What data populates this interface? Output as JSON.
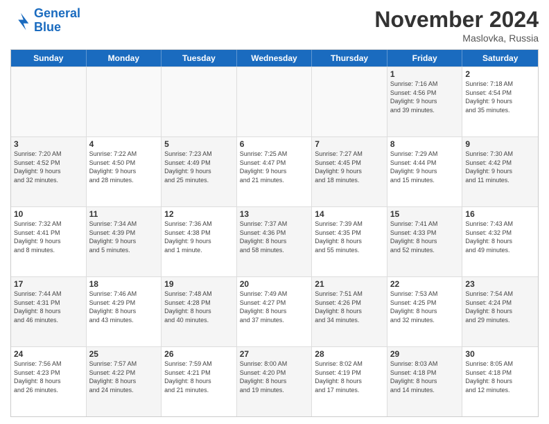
{
  "header": {
    "logo_line1": "General",
    "logo_line2": "Blue",
    "month": "November 2024",
    "location": "Maslovka, Russia"
  },
  "days_of_week": [
    "Sunday",
    "Monday",
    "Tuesday",
    "Wednesday",
    "Thursday",
    "Friday",
    "Saturday"
  ],
  "rows": [
    [
      {
        "day": "",
        "info": "",
        "empty": true
      },
      {
        "day": "",
        "info": "",
        "empty": true
      },
      {
        "day": "",
        "info": "",
        "empty": true
      },
      {
        "day": "",
        "info": "",
        "empty": true
      },
      {
        "day": "",
        "info": "",
        "empty": true
      },
      {
        "day": "1",
        "info": "Sunrise: 7:16 AM\nSunset: 4:56 PM\nDaylight: 9 hours\nand 39 minutes.",
        "shaded": true
      },
      {
        "day": "2",
        "info": "Sunrise: 7:18 AM\nSunset: 4:54 PM\nDaylight: 9 hours\nand 35 minutes.",
        "shaded": false
      }
    ],
    [
      {
        "day": "3",
        "info": "Sunrise: 7:20 AM\nSunset: 4:52 PM\nDaylight: 9 hours\nand 32 minutes.",
        "shaded": true
      },
      {
        "day": "4",
        "info": "Sunrise: 7:22 AM\nSunset: 4:50 PM\nDaylight: 9 hours\nand 28 minutes.",
        "shaded": false
      },
      {
        "day": "5",
        "info": "Sunrise: 7:23 AM\nSunset: 4:49 PM\nDaylight: 9 hours\nand 25 minutes.",
        "shaded": true
      },
      {
        "day": "6",
        "info": "Sunrise: 7:25 AM\nSunset: 4:47 PM\nDaylight: 9 hours\nand 21 minutes.",
        "shaded": false
      },
      {
        "day": "7",
        "info": "Sunrise: 7:27 AM\nSunset: 4:45 PM\nDaylight: 9 hours\nand 18 minutes.",
        "shaded": true
      },
      {
        "day": "8",
        "info": "Sunrise: 7:29 AM\nSunset: 4:44 PM\nDaylight: 9 hours\nand 15 minutes.",
        "shaded": false
      },
      {
        "day": "9",
        "info": "Sunrise: 7:30 AM\nSunset: 4:42 PM\nDaylight: 9 hours\nand 11 minutes.",
        "shaded": true
      }
    ],
    [
      {
        "day": "10",
        "info": "Sunrise: 7:32 AM\nSunset: 4:41 PM\nDaylight: 9 hours\nand 8 minutes.",
        "shaded": false
      },
      {
        "day": "11",
        "info": "Sunrise: 7:34 AM\nSunset: 4:39 PM\nDaylight: 9 hours\nand 5 minutes.",
        "shaded": true
      },
      {
        "day": "12",
        "info": "Sunrise: 7:36 AM\nSunset: 4:38 PM\nDaylight: 9 hours\nand 1 minute.",
        "shaded": false
      },
      {
        "day": "13",
        "info": "Sunrise: 7:37 AM\nSunset: 4:36 PM\nDaylight: 8 hours\nand 58 minutes.",
        "shaded": true
      },
      {
        "day": "14",
        "info": "Sunrise: 7:39 AM\nSunset: 4:35 PM\nDaylight: 8 hours\nand 55 minutes.",
        "shaded": false
      },
      {
        "day": "15",
        "info": "Sunrise: 7:41 AM\nSunset: 4:33 PM\nDaylight: 8 hours\nand 52 minutes.",
        "shaded": true
      },
      {
        "day": "16",
        "info": "Sunrise: 7:43 AM\nSunset: 4:32 PM\nDaylight: 8 hours\nand 49 minutes.",
        "shaded": false
      }
    ],
    [
      {
        "day": "17",
        "info": "Sunrise: 7:44 AM\nSunset: 4:31 PM\nDaylight: 8 hours\nand 46 minutes.",
        "shaded": true
      },
      {
        "day": "18",
        "info": "Sunrise: 7:46 AM\nSunset: 4:29 PM\nDaylight: 8 hours\nand 43 minutes.",
        "shaded": false
      },
      {
        "day": "19",
        "info": "Sunrise: 7:48 AM\nSunset: 4:28 PM\nDaylight: 8 hours\nand 40 minutes.",
        "shaded": true
      },
      {
        "day": "20",
        "info": "Sunrise: 7:49 AM\nSunset: 4:27 PM\nDaylight: 8 hours\nand 37 minutes.",
        "shaded": false
      },
      {
        "day": "21",
        "info": "Sunrise: 7:51 AM\nSunset: 4:26 PM\nDaylight: 8 hours\nand 34 minutes.",
        "shaded": true
      },
      {
        "day": "22",
        "info": "Sunrise: 7:53 AM\nSunset: 4:25 PM\nDaylight: 8 hours\nand 32 minutes.",
        "shaded": false
      },
      {
        "day": "23",
        "info": "Sunrise: 7:54 AM\nSunset: 4:24 PM\nDaylight: 8 hours\nand 29 minutes.",
        "shaded": true
      }
    ],
    [
      {
        "day": "24",
        "info": "Sunrise: 7:56 AM\nSunset: 4:23 PM\nDaylight: 8 hours\nand 26 minutes.",
        "shaded": false
      },
      {
        "day": "25",
        "info": "Sunrise: 7:57 AM\nSunset: 4:22 PM\nDaylight: 8 hours\nand 24 minutes.",
        "shaded": true
      },
      {
        "day": "26",
        "info": "Sunrise: 7:59 AM\nSunset: 4:21 PM\nDaylight: 8 hours\nand 21 minutes.",
        "shaded": false
      },
      {
        "day": "27",
        "info": "Sunrise: 8:00 AM\nSunset: 4:20 PM\nDaylight: 8 hours\nand 19 minutes.",
        "shaded": true
      },
      {
        "day": "28",
        "info": "Sunrise: 8:02 AM\nSunset: 4:19 PM\nDaylight: 8 hours\nand 17 minutes.",
        "shaded": false
      },
      {
        "day": "29",
        "info": "Sunrise: 8:03 AM\nSunset: 4:18 PM\nDaylight: 8 hours\nand 14 minutes.",
        "shaded": true
      },
      {
        "day": "30",
        "info": "Sunrise: 8:05 AM\nSunset: 4:18 PM\nDaylight: 8 hours\nand 12 minutes.",
        "shaded": false
      }
    ]
  ]
}
